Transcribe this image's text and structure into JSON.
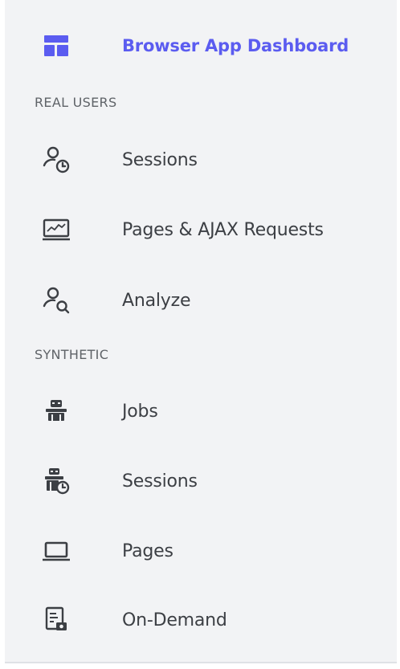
{
  "nav": {
    "dashboard": {
      "label": "Browser App Dashboard",
      "icon": "dashboard-icon",
      "active": true
    },
    "sections": [
      {
        "title": "REAL USERS",
        "items": [
          {
            "label": "Sessions",
            "icon": "user-clock-icon"
          },
          {
            "label": "Pages & AJAX Requests",
            "icon": "monitor-chart-icon"
          },
          {
            "label": "Analyze",
            "icon": "user-search-icon"
          }
        ]
      },
      {
        "title": "SYNTHETIC",
        "items": [
          {
            "label": "Jobs",
            "icon": "robot-icon"
          },
          {
            "label": "Sessions",
            "icon": "robot-clock-icon"
          },
          {
            "label": "Pages",
            "icon": "laptop-icon"
          },
          {
            "label": "On-Demand",
            "icon": "document-camera-icon"
          }
        ]
      }
    ]
  },
  "colors": {
    "accent": "#5b5cf0",
    "text": "#3c3f44",
    "section_text": "#5f6368",
    "icon": "#3c3f44",
    "background": "#f2f3f5"
  }
}
